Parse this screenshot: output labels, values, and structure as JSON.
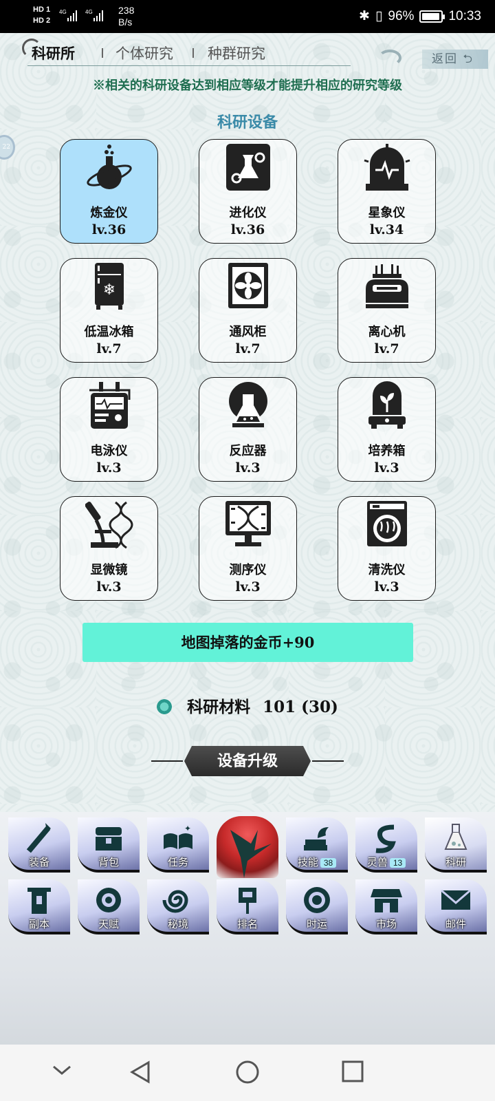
{
  "status_bar": {
    "sim1": "HD 1",
    "sim2": "HD 2",
    "net1": "4G",
    "net2": "4G",
    "speed_value": "238",
    "speed_unit": "B/s",
    "battery": "96%",
    "time": "10:33"
  },
  "nav": {
    "tabs": [
      {
        "label": "科研所",
        "active": true
      },
      {
        "label": "个体研究",
        "active": false
      },
      {
        "label": "种群研究",
        "active": false
      }
    ],
    "back_label": "返回"
  },
  "notice": "※相关的科研设备达到相应等级才能提升相应的研究等级",
  "section_title": "科研设备",
  "side_bubble_text": "22",
  "devices": [
    {
      "name": "炼金仪",
      "level": "lv.36",
      "icon": "alchemy-flask-icon",
      "selected": true
    },
    {
      "name": "进化仪",
      "level": "lv.36",
      "icon": "evolution-device-icon",
      "selected": false
    },
    {
      "name": "星象仪",
      "level": "lv.34",
      "icon": "astrology-monitor-icon",
      "selected": false
    },
    {
      "name": "低温冰箱",
      "level": "lv.7",
      "icon": "freezer-icon",
      "selected": false
    },
    {
      "name": "通风柜",
      "level": "lv.7",
      "icon": "fume-hood-icon",
      "selected": false
    },
    {
      "name": "离心机",
      "level": "lv.7",
      "icon": "centrifuge-icon",
      "selected": false
    },
    {
      "name": "电泳仪",
      "level": "lv.3",
      "icon": "electrophoresis-icon",
      "selected": false
    },
    {
      "name": "反应器",
      "level": "lv.3",
      "icon": "reactor-icon",
      "selected": false
    },
    {
      "name": "培养箱",
      "level": "lv.3",
      "icon": "incubator-icon",
      "selected": false
    },
    {
      "name": "显微镜",
      "level": "lv.3",
      "icon": "microscope-icon",
      "selected": false
    },
    {
      "name": "测序仪",
      "level": "lv.3",
      "icon": "sequencer-icon",
      "selected": false
    },
    {
      "name": "清洗仪",
      "level": "lv.3",
      "icon": "washer-icon",
      "selected": false
    }
  ],
  "bonus_text": "地图掉落的金币+90",
  "material": {
    "label": "科研材料",
    "amount": "101",
    "extra": "(30)"
  },
  "upgrade_label": "设备升级",
  "menu": {
    "row1": [
      {
        "label": "装备",
        "icon": "torch-icon"
      },
      {
        "label": "背包",
        "icon": "chest-icon"
      },
      {
        "label": "任务",
        "icon": "book-icon"
      },
      {
        "label": "",
        "icon": "star-center-icon"
      },
      {
        "label": "技能",
        "icon": "skill-dragon-icon",
        "badge": "38"
      },
      {
        "label": "灵兽",
        "icon": "dragon-icon",
        "badge": "13"
      },
      {
        "label": "科研",
        "icon": "flask-icon",
        "active": true
      }
    ],
    "row2": [
      {
        "label": "副本",
        "icon": "tower-icon"
      },
      {
        "label": "天赋",
        "icon": "gear-icon"
      },
      {
        "label": "秘境",
        "icon": "spiral-icon"
      },
      {
        "label": "排名",
        "icon": "banner-icon"
      },
      {
        "label": "时运",
        "icon": "fortune-wheel-icon"
      },
      {
        "label": "市场",
        "icon": "shop-icon"
      },
      {
        "label": "邮件",
        "icon": "mail-icon"
      }
    ]
  },
  "colors": {
    "selected_device": "#aee0fb",
    "bonus_bar": "#62f2d8",
    "notice_text": "#1f6e50",
    "section_title": "#3a8aa8",
    "research_center": "#c62a2a"
  }
}
